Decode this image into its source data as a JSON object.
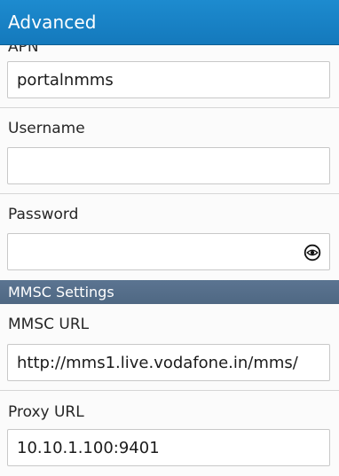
{
  "header": {
    "title": "Advanced"
  },
  "apn": {
    "label": "APN",
    "value": "portalnmms"
  },
  "username": {
    "label": "Username",
    "value": ""
  },
  "password": {
    "label": "Password",
    "value": "",
    "toggle_icon": "eye-icon"
  },
  "mmsc_section": {
    "title": "MMSC Settings"
  },
  "mmsc_url": {
    "label": "MMSC URL",
    "value": "http://mms1.live.vodafone.in/mms/"
  },
  "proxy_url": {
    "label": "Proxy URL",
    "value": "10.10.1.100:9401"
  },
  "colors": {
    "titlebar": "#1479bc",
    "section_header": "#4f6883",
    "background": "#fbfbfb"
  }
}
